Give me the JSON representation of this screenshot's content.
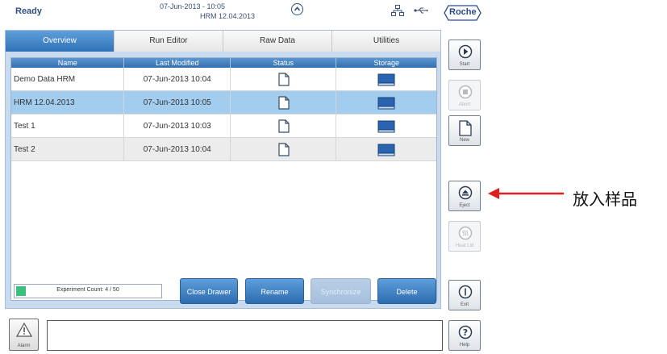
{
  "header": {
    "status": "Ready",
    "datetime": "07-Jun-2013 - 10:05",
    "current_run": "HRM 12.04.2013",
    "icons": [
      "up-arrow-icon",
      "network-icon",
      "usb-icon"
    ],
    "logo_text": "Roche"
  },
  "tabs": [
    {
      "label": "Overview",
      "active": true
    },
    {
      "label": "Run Editor",
      "active": false
    },
    {
      "label": "Raw Data",
      "active": false
    },
    {
      "label": "Utilities",
      "active": false
    }
  ],
  "table": {
    "columns": [
      "Name",
      "Last Modified",
      "Status",
      "Storage"
    ],
    "rows": [
      {
        "name": "Demo Data HRM",
        "modified": "07-Jun-2013 10:04",
        "status_icon": "document-icon",
        "storage_icon": "book-icon"
      },
      {
        "name": "HRM 12.04.2013",
        "modified": "07-Jun-2013 10:05",
        "status_icon": "document-icon",
        "storage_icon": "book-icon",
        "selected": true
      },
      {
        "name": "Test 1",
        "modified": "07-Jun-2013 10:03",
        "status_icon": "document-icon",
        "storage_icon": "book-icon"
      },
      {
        "name": "Test 2",
        "modified": "07-Jun-2013 10:04",
        "status_icon": "document-icon",
        "storage_icon": "book-icon"
      }
    ]
  },
  "experiment_count": {
    "label": "Experiment Count: 4 / 50",
    "fraction": 0.08
  },
  "buttons": {
    "close_drawer": "Close Drawer",
    "rename": "Rename",
    "synchronize": "Synchronize",
    "delete": "Delete"
  },
  "rail": {
    "start": "Start",
    "abort": "Abort",
    "new": "New",
    "eject": "Eject",
    "heat_lid": "Heat Lid",
    "exit": "Exit",
    "help": "Help"
  },
  "alarm_label": "Alarm",
  "annotation": "放入样品",
  "colors": {
    "accent": "#2f72b8",
    "selected_row": "#a3cdef",
    "panel_bg": "#c9dcef",
    "annotation_arrow": "#e02020"
  }
}
